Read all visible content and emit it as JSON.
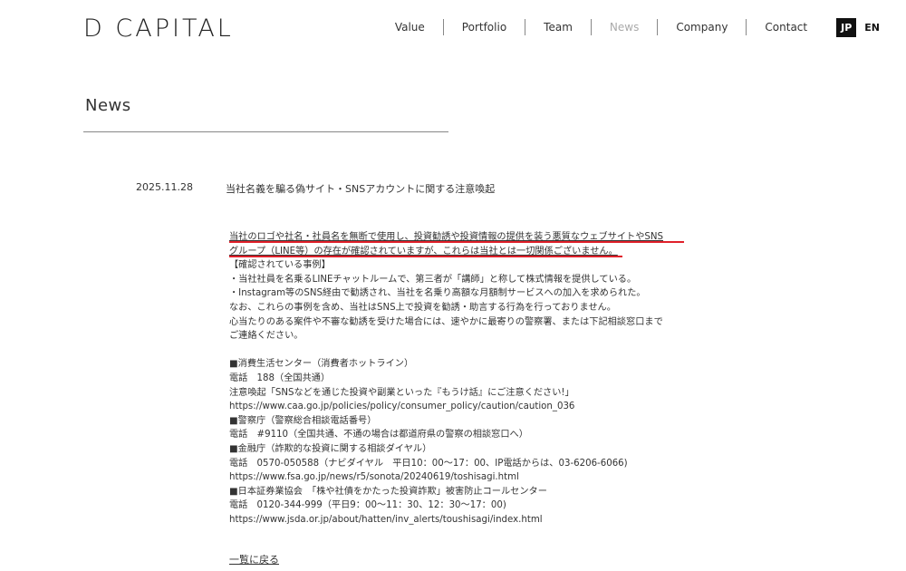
{
  "brand": "D CAPITAL",
  "nav": {
    "items": [
      "Value",
      "Portfolio",
      "Team",
      "News",
      "Company",
      "Contact"
    ],
    "active": "News"
  },
  "lang": {
    "jp": "JP",
    "en": "EN",
    "selected": "JP"
  },
  "page": {
    "title": "News"
  },
  "post": {
    "date": "2025.11.28",
    "title": "当社名義を騙る偽サイト・SNSアカウントに関する注意喚起",
    "lines": [
      "当社のロゴや社名・社員名を無断で使用し、投資勧誘や投資情報の提供を装う悪質なウェブサイトやSNS",
      "グループ（LINE等）の存在が確認されていますが、これらは当社とは一切関係ございません。",
      "【確認されている事例】",
      "・当社社員を名乗るLINEチャットルームで、第三者が「講師」と称して株式情報を提供している。",
      "・Instagram等のSNS経由で勧誘され、当社を名乗り高額な月額制サービスへの加入を求められた。",
      "なお、これらの事例を含め、当社はSNS上で投資を勧誘・助言する行為を行っておりません。",
      "心当たりのある案件や不審な勧誘を受けた場合には、速やかに最寄りの警察署、または下記相談窓口まで",
      "ご連絡ください。",
      "",
      "■消費生活センター（消費者ホットライン）",
      "電話　188（全国共通）",
      "注意喚起「SNSなどを通じた投資や副業といった『もうけ話』にご注意ください!」",
      "https://www.caa.go.jp/policies/policy/consumer_policy/caution/caution_036",
      "■警察庁（警察総合相談電話番号）",
      "電話　#9110（全国共通、不通の場合は都道府県の警察の相談窓口へ）",
      "■金融庁（詐欺的な投資に関する相談ダイヤル）",
      "電話　0570-050588（ナビダイヤル　平日10：00～17：00、IP電話からは、03-6206-6066)",
      "https://www.fsa.go.jp/news/r5/sonota/20240619/toshisagi.html",
      "■日本証券業協会　「株や社債をかたった投資詐欺」被害防止コールセンター",
      "電話　0120-344-999（平日9：00～11：30、12：30～17：00)",
      "https://www.jsda.or.jp/about/hatten/inv_alerts/toushisagi/index.html"
    ]
  },
  "back_link": "一覧に戻る",
  "colors": {
    "highlight_underline": "#e0202a",
    "active_nav": "#aaaaaa",
    "lang_active_bg": "#111111"
  }
}
